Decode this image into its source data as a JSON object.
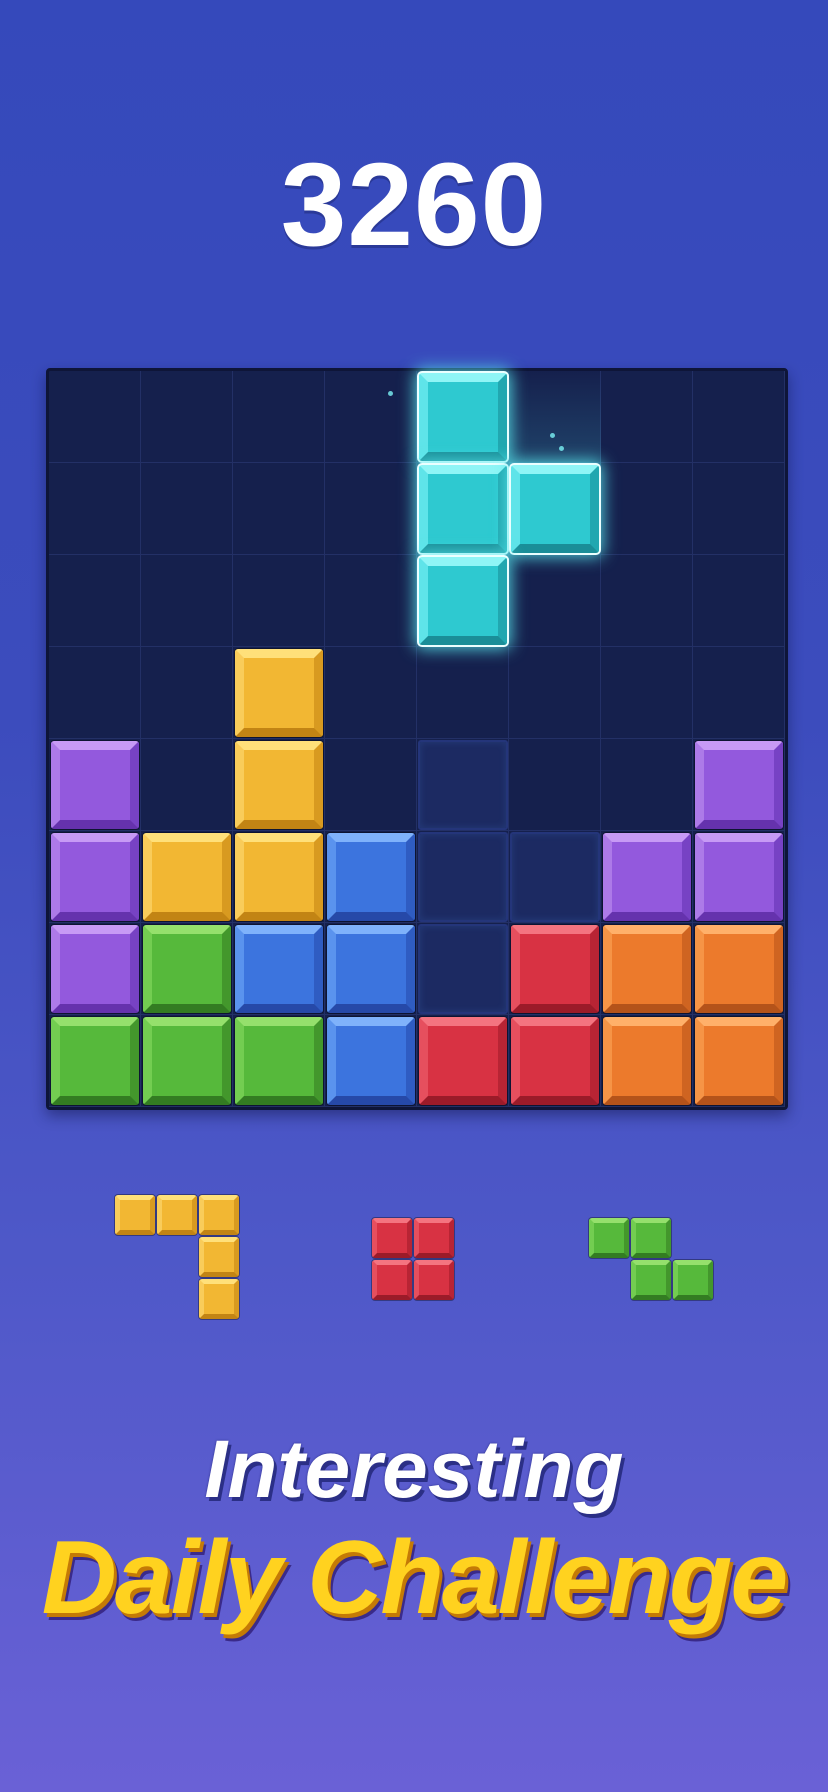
{
  "game": {
    "score": "3260",
    "board": {
      "rows": 8,
      "cols": 8
    },
    "colors": {
      "cyan": {
        "base": "#2ec9d0",
        "light": "#8ff5f6",
        "light2": "#5fe4e9",
        "dark": "#1a8e98",
        "dark2": "#21a7b0"
      },
      "yellow": {
        "base": "#f2b733",
        "light": "#ffe07a",
        "light2": "#f9cc5a",
        "dark": "#c28414",
        "dark2": "#d89a20"
      },
      "purple": {
        "base": "#9359dd",
        "light": "#c79af5",
        "light2": "#ad7ae8",
        "dark": "#6532ad",
        "dark2": "#7742c4"
      },
      "blue": {
        "base": "#3c74de",
        "light": "#7fb2fb",
        "light2": "#5a93ee",
        "dark": "#2649a8",
        "dark2": "#2f5cc2"
      },
      "green": {
        "base": "#56b93b",
        "light": "#95e06c",
        "light2": "#73cd51",
        "dark": "#337c22",
        "dark2": "#43972c"
      },
      "red": {
        "base": "#d83243",
        "light": "#f47480",
        "light2": "#e64f5e",
        "dark": "#9b1b29",
        "dark2": "#b82434"
      },
      "orange": {
        "base": "#ec7a2c",
        "light": "#ffb06a",
        "light2": "#f69446",
        "dark": "#b4531a",
        "dark2": "#cf6421"
      }
    },
    "placed_blocks": [
      {
        "r": 3,
        "c": 2,
        "color": "yellow"
      },
      {
        "r": 4,
        "c": 0,
        "color": "purple"
      },
      {
        "r": 4,
        "c": 2,
        "color": "yellow"
      },
      {
        "r": 4,
        "c": 7,
        "color": "purple"
      },
      {
        "r": 5,
        "c": 0,
        "color": "purple"
      },
      {
        "r": 5,
        "c": 1,
        "color": "yellow"
      },
      {
        "r": 5,
        "c": 2,
        "color": "yellow"
      },
      {
        "r": 5,
        "c": 3,
        "color": "blue"
      },
      {
        "r": 5,
        "c": 6,
        "color": "purple"
      },
      {
        "r": 5,
        "c": 7,
        "color": "purple"
      },
      {
        "r": 6,
        "c": 0,
        "color": "purple"
      },
      {
        "r": 6,
        "c": 1,
        "color": "green"
      },
      {
        "r": 6,
        "c": 2,
        "color": "blue"
      },
      {
        "r": 6,
        "c": 3,
        "color": "blue"
      },
      {
        "r": 6,
        "c": 5,
        "color": "red"
      },
      {
        "r": 6,
        "c": 6,
        "color": "orange"
      },
      {
        "r": 6,
        "c": 7,
        "color": "orange"
      },
      {
        "r": 7,
        "c": 0,
        "color": "green"
      },
      {
        "r": 7,
        "c": 1,
        "color": "green"
      },
      {
        "r": 7,
        "c": 2,
        "color": "green"
      },
      {
        "r": 7,
        "c": 3,
        "color": "blue"
      },
      {
        "r": 7,
        "c": 4,
        "color": "red"
      },
      {
        "r": 7,
        "c": 5,
        "color": "red"
      },
      {
        "r": 7,
        "c": 6,
        "color": "orange"
      },
      {
        "r": 7,
        "c": 7,
        "color": "orange"
      }
    ],
    "target_slots": [
      {
        "r": 4,
        "c": 4
      },
      {
        "r": 5,
        "c": 4
      },
      {
        "r": 5,
        "c": 5
      },
      {
        "r": 6,
        "c": 4
      }
    ],
    "active_piece": {
      "color": "cyan",
      "cells": [
        {
          "r": 0,
          "c": 4
        },
        {
          "r": 1,
          "c": 4
        },
        {
          "r": 1,
          "c": 5
        },
        {
          "r": 2,
          "c": 4
        }
      ]
    },
    "tray_pieces": [
      {
        "name": "yellow-l-piece",
        "color": "yellow",
        "cells": [
          [
            0,
            0
          ],
          [
            0,
            1
          ],
          [
            0,
            2
          ],
          [
            1,
            2
          ],
          [
            2,
            2
          ]
        ]
      },
      {
        "name": "red-square-piece",
        "color": "red",
        "cells": [
          [
            0,
            0
          ],
          [
            0,
            1
          ],
          [
            1,
            0
          ],
          [
            1,
            1
          ]
        ]
      },
      {
        "name": "green-z-piece",
        "color": "green",
        "cells": [
          [
            0,
            0
          ],
          [
            0,
            1
          ],
          [
            1,
            1
          ],
          [
            1,
            2
          ]
        ]
      }
    ]
  },
  "promo": {
    "tagline": "Interesting",
    "headline": "Daily Challenge"
  }
}
